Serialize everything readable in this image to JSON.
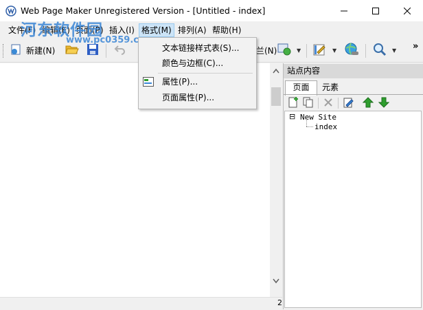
{
  "window": {
    "title": "Web Page Maker Unregistered Version - [Untitled - index]",
    "minimize_glyph": "—",
    "maximize_glyph": "☐",
    "close_glyph": "✕"
  },
  "watermark": {
    "text": "河东软件园",
    "url": "www.pc0359.cn"
  },
  "menu": {
    "file": "文件(F)",
    "edit": "编辑(E)",
    "page": "页面(P)",
    "insert": "插入(I)",
    "format": "格式(M)",
    "arrange": "排列(A)",
    "help": "帮助(H)"
  },
  "toolbar": {
    "new_label": "新建(N)",
    "partial_label": "兰(N)",
    "overflow": "»"
  },
  "format_menu": {
    "items": [
      "文本链接样式表(S)...",
      "颜色与边框(C)...",
      "属性(P)...",
      "页面属性(P)..."
    ]
  },
  "panel": {
    "title": "站点内容",
    "tab_page": "页面",
    "tab_elements": "元素",
    "tree_root": "New Site",
    "tree_child": "index",
    "tree_expander": "⊟"
  },
  "status": {
    "right_fragment": "2"
  },
  "colors": {
    "accent": "#3a86d6",
    "menu_highlight": "#cce4f7",
    "green_arrow": "#2e9e2e"
  }
}
